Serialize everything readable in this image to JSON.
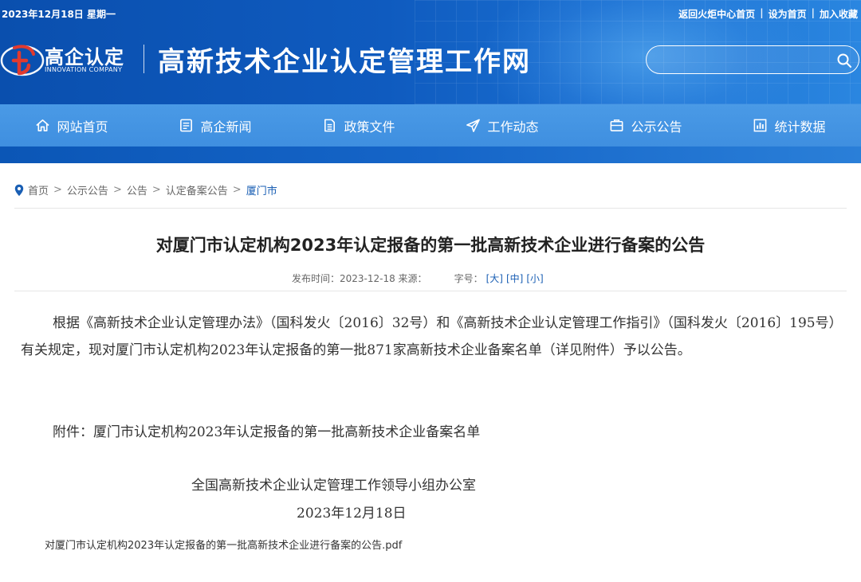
{
  "topbar": {
    "date": "2023年12月18日 星期一",
    "links": [
      "返回火炬中心首页",
      "设为首页",
      "加入收藏"
    ],
    "separator": "|"
  },
  "logo": {
    "name": "高企认定",
    "subtitle": "INNOVATION COMPANY",
    "color": "#e03a2f"
  },
  "site": {
    "title": "高新技术企业认定管理工作网"
  },
  "search": {
    "value": "",
    "placeholder": ""
  },
  "nav": {
    "items": [
      {
        "label": "网站首页",
        "icon": "home-icon"
      },
      {
        "label": "高企新闻",
        "icon": "news-icon"
      },
      {
        "label": "政策文件",
        "icon": "document-icon"
      },
      {
        "label": "工作动态",
        "icon": "paper-plane-icon"
      },
      {
        "label": "公示公告",
        "icon": "notice-icon"
      },
      {
        "label": "统计数据",
        "icon": "chart-icon"
      }
    ]
  },
  "breadcrumb": {
    "items": [
      "首页",
      "公示公告",
      "公告",
      "认定备案公告",
      "厦门市"
    ],
    "separator": ">"
  },
  "article": {
    "title": "对厦门市认定机构2023年认定报备的第一批高新技术企业进行备案的公告",
    "meta": {
      "publish_label": "发布时间：2023-12-18 来源：",
      "font_size_label": "字号：",
      "sizes": [
        "[大]",
        "[中]",
        "[小]"
      ]
    },
    "paragraph1": "根据《高新技术企业认定管理办法》（国科发火〔2016〕32号）和《高新技术企业认定管理工作指引》（国科发火〔2016〕195号）有关规定，现对厦门市认定机构2023年认定报备的第一批871家高新技术企业备案名单（详见附件）予以公告。",
    "attachment_text": "附件：厦门市认定机构2023年认定报备的第一批高新技术企业备案名单",
    "signature_org": "全国高新技术企业认定管理工作领导小组办公室",
    "signature_date": "2023年12月18日",
    "pdf_link": "对厦门市认定机构2023年认定报备的第一批高新技术企业进行备案的公告.pdf"
  },
  "colors": {
    "header_blue": "#0f5bbf",
    "nav_blue": "#4a9ae6",
    "link_blue": "#1a5fb4"
  }
}
